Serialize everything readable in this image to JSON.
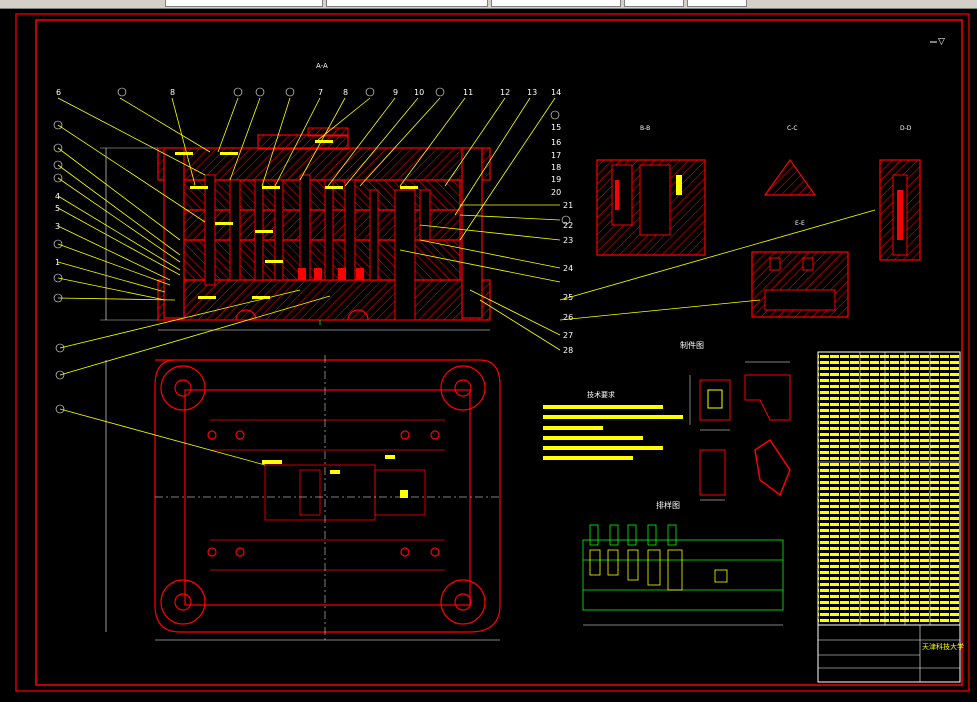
{
  "toolbar": {
    "icons": [
      "lightbulb-icon",
      "shield-icon"
    ],
    "combo_1": "",
    "combo_2": "",
    "combo_3": "",
    "combo_4": "",
    "combo_5": ""
  },
  "drawing": {
    "section_label_main": "A-A",
    "section_label_b": "B-B",
    "section_label_c": "C-C",
    "section_label_d": "D-D",
    "section_label_e": "E-E",
    "part_drawing_title": "制件图",
    "layout_drawing_title": "排样图",
    "tech_requirements_title": "技术要求",
    "roughness_symbol": "▽",
    "university_name": "天津科技大学",
    "drawing_subtitle": "",
    "drawing_code": "",
    "top_callouts": [
      "6",
      "",
      "8",
      "",
      "",
      "",
      "7",
      "8",
      "",
      "9",
      "10",
      "",
      "11",
      "12",
      "13",
      "14"
    ],
    "left_callouts": [
      "",
      "",
      "",
      "",
      "4",
      "5",
      "3",
      "",
      "1",
      "",
      ""
    ],
    "right_callouts": [
      "15",
      "16",
      "17",
      "18",
      "19",
      "20",
      "",
      "",
      "",
      "",
      "",
      "",
      "",
      "",
      ""
    ],
    "right_lower_callouts": [
      "21",
      "",
      "22",
      "23",
      "24",
      "",
      "25",
      "",
      "26",
      "",
      "27",
      "28"
    ],
    "bottom_callouts": [
      "",
      "",
      ""
    ]
  },
  "colors": {
    "background": "#000000",
    "frame": "#ff0000",
    "leader": "#ffff00",
    "dimension": "#00ff00",
    "text": "#ffffff",
    "hatch": "#ff0000"
  }
}
